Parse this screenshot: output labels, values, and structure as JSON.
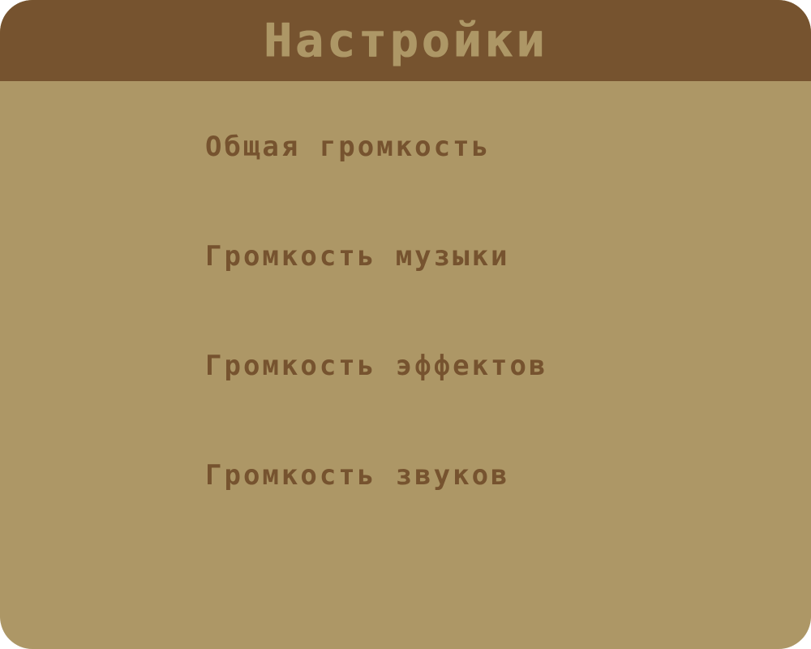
{
  "colors": {
    "panel_background": "#ad9766",
    "header_background": "#76532f",
    "title_text": "#ad9766",
    "item_text": "#76532f"
  },
  "header": {
    "title": "Настройки"
  },
  "menu": {
    "items": [
      {
        "label": "Общая громкость"
      },
      {
        "label": "Громкость музыки"
      },
      {
        "label": "Громкость эффектов"
      },
      {
        "label": "Громкость звуков"
      }
    ]
  }
}
